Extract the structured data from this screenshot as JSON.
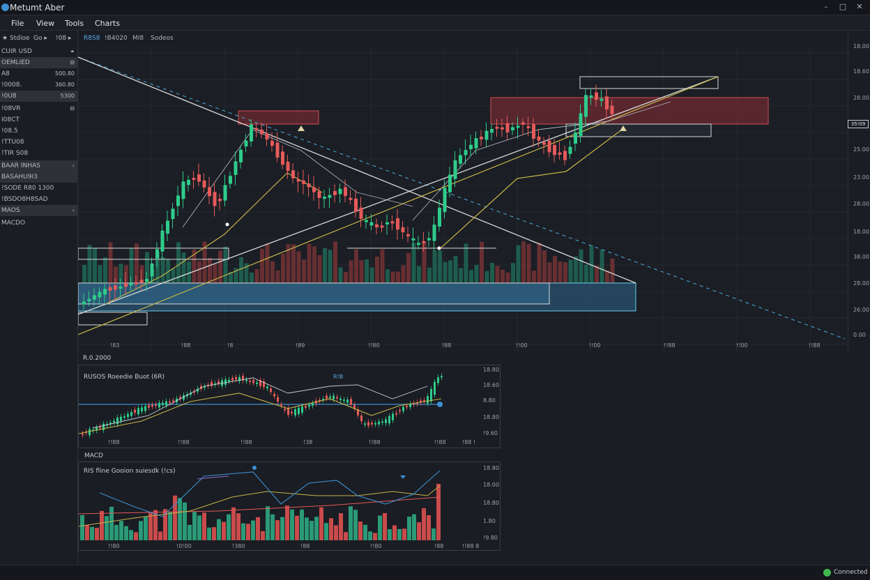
{
  "window": {
    "title": "Metumt Aber",
    "controls": [
      "–",
      "□",
      "✕"
    ]
  },
  "menu": [
    "File",
    "View",
    "Tools",
    "Charts"
  ],
  "sidebar": {
    "toolbar": [
      "★",
      "Stdioe",
      "Go ▸",
      "!08 ▸"
    ],
    "rows": [
      {
        "label": "CUIR USD",
        "value": "⏶",
        "hl": false
      },
      {
        "label": "OEMLIED",
        "value": "⊟",
        "hl": true
      },
      {
        "label": "A8",
        "value": "500.80",
        "hl": false
      },
      {
        "label": "!0008.",
        "value": "360.80",
        "hl": false
      },
      {
        "label": "!0U8",
        "value": "5300",
        "hl": true
      },
      {
        "label": "!08VR",
        "value": "⊟",
        "hl": false
      },
      {
        "label": "I08CT",
        "value": "",
        "hl": false
      },
      {
        "label": "!08.5",
        "value": "",
        "hl": false
      },
      {
        "label": "!TTU08",
        "value": "",
        "hl": false
      },
      {
        "label": "!TIR S08",
        "value": "",
        "hl": false
      },
      {
        "label": "BAAR INHAS",
        "value": "›",
        "hl": true
      },
      {
        "label": "BASAHU9I3",
        "value": "",
        "hl": true
      },
      {
        "label": "!SODE R80 1300",
        "value": "",
        "hl": false
      },
      {
        "label": "!BSDO8H8SAD",
        "value": "",
        "hl": false
      },
      {
        "label": "MAOS",
        "value": "›",
        "hl": true
      },
      {
        "label": "MACDO",
        "value": "",
        "hl": false
      }
    ]
  },
  "chart_toolbar": [
    "R8S8",
    "!B4020",
    "MI8",
    "Sodeos"
  ],
  "price_axis": {
    "labels": [
      "18.00",
      "18.60",
      "28.00",
      "25.00",
      "23.00",
      "28.00",
      "18.00",
      "38.00",
      "28.00",
      "26.00",
      "0.00"
    ],
    "current": "35!09"
  },
  "time_axis": [
    "!83",
    "!88",
    "!8",
    "!89",
    "!!80",
    "!88",
    "!!00",
    "!!00",
    "!!88",
    "!!00",
    "!!88"
  ],
  "rsi_panel": {
    "title": "R.0.2000",
    "subtitle": "RUSOS Roeedie Buot (6R)",
    "marker": "R!B",
    "axis": [
      "18.80",
      "18.60",
      "8.80",
      "18.80",
      "!9.60"
    ],
    "xlabels": [
      "!!88",
      "!!88",
      "!!88",
      "!38",
      "!!88",
      "!!88",
      "!88 !"
    ]
  },
  "macd_panel": {
    "title": "MACD",
    "subtitle": "RIS fline Gooion suiesdk (!cs)",
    "axis": [
      "18.80",
      "18.00",
      "18.80",
      "1.80",
      "!9.80"
    ],
    "xlabels": [
      "!!80",
      "!0!00",
      "!380",
      "!88",
      "!!80",
      "!88",
      "!!88 8"
    ]
  },
  "status": {
    "connection": "Connected"
  },
  "colors": {
    "up": "#2ecc8a",
    "down": "#e55a5a",
    "accent": "#3d8fd1",
    "trend": "#d9d9d9",
    "ma": "#c6b44a"
  }
}
